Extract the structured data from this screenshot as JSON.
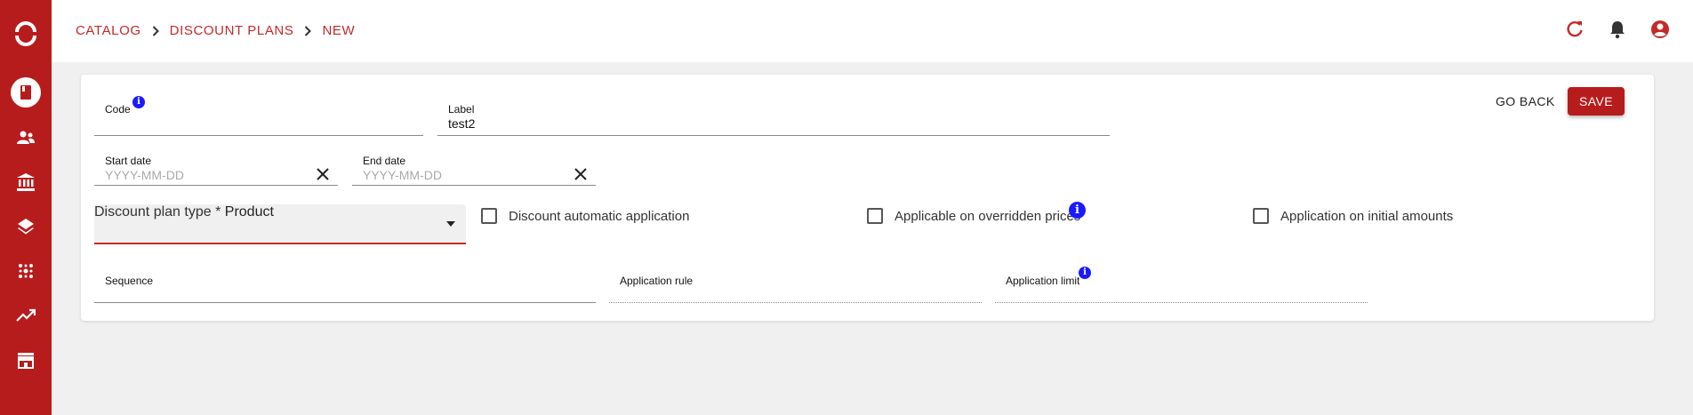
{
  "sidebar": {
    "items": [
      {
        "icon": "logo-icon"
      },
      {
        "icon": "book-icon",
        "active": true
      },
      {
        "icon": "users-icon"
      },
      {
        "icon": "bank-icon"
      },
      {
        "icon": "layers-icon"
      },
      {
        "icon": "grid-dots-icon"
      },
      {
        "icon": "trending-up-icon"
      },
      {
        "icon": "store-icon"
      }
    ]
  },
  "breadcrumb": {
    "items": [
      "CATALOG",
      "DISCOUNT PLANS",
      "NEW"
    ]
  },
  "header": {
    "icons": [
      "refresh-icon",
      "bell-icon",
      "account-icon"
    ]
  },
  "form": {
    "code": {
      "label": "Code",
      "value": ""
    },
    "label": {
      "label": "Label",
      "value": "test2"
    },
    "start_date": {
      "label": "Start date",
      "placeholder": "YYYY-MM-DD"
    },
    "end_date": {
      "label": "End date",
      "placeholder": "YYYY-MM-DD"
    },
    "discount_plan_type": {
      "label": "Discount plan type *",
      "value": "Product"
    },
    "checkboxes": [
      {
        "label": "Discount automatic application",
        "checked": false
      },
      {
        "label": "Applicable on overridden prices",
        "checked": false
      },
      {
        "label": "Application on initial amounts",
        "checked": false
      }
    ],
    "sequence": {
      "label": "Sequence"
    },
    "application_rule": {
      "label": "Application rule"
    },
    "application_limit": {
      "label": "Application limit"
    }
  },
  "actions": {
    "go_back": "GO BACK",
    "save": "SAVE"
  },
  "colors": {
    "primary": "#b71c1c",
    "info": "#1a1aff",
    "background": "#f0f0f0"
  }
}
